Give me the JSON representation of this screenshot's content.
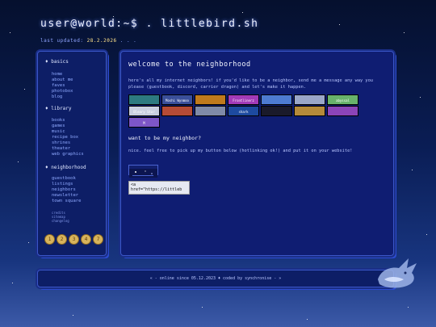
{
  "header": {
    "title": "user@world:~$ . littlebird.sh",
    "updated_label": "last updated:",
    "updated_date": "28.2.2026",
    "updated_suffix": ". . ."
  },
  "sidebar": {
    "basics": {
      "heading": "basics",
      "links": [
        "home",
        "about me",
        "faves",
        "photobox",
        "blog"
      ]
    },
    "library": {
      "heading": "library",
      "links": [
        "books",
        "games",
        "music",
        "recipe box",
        "shrines",
        "theater",
        "web graphics"
      ]
    },
    "neighborhood": {
      "heading": "neighborhood",
      "links": [
        "guestbook",
        "listings",
        "neighbors",
        "newsletter",
        "town square"
      ]
    },
    "tiny_links": [
      "credits",
      "sitemap",
      "changelog"
    ],
    "badges": [
      "1",
      "2",
      "3",
      "4",
      "7"
    ]
  },
  "main": {
    "title": "welcome to the neighborhood",
    "intro": "here's all my internet neighbors! if you'd like to be a neighbor, send me a message any way you please (guestbook, discord, carrier dragon) and let's make it happen.",
    "buttons": [
      {
        "label": "",
        "bg": "#2d7a80"
      },
      {
        "label": "Moshi Wynmoo",
        "bg": "#3a4f9a"
      },
      {
        "label": "",
        "bg": "#c07a1d"
      },
      {
        "label": "Frontlinerz Gaming",
        "bg": "#a23ab8"
      },
      {
        "label": "",
        "bg": "#4d7bd1"
      },
      {
        "label": "",
        "bg": "#9aa6c8"
      },
      {
        "label": "abyssal drowning",
        "bg": "#68b26b"
      },
      {
        "label": "Bleary Star Games",
        "bg": "#c9cfe0"
      },
      {
        "label": "",
        "bg": "#b64b36"
      },
      {
        "label": "",
        "bg": "#7f8aa8"
      },
      {
        "label": "shark",
        "bg": "#1d4aa0"
      },
      {
        "label": "",
        "bg": "#1a1a2a"
      },
      {
        "label": "",
        "bg": "#b58a3a"
      },
      {
        "label": "",
        "bg": "#8b44b8"
      },
      {
        "label": "M",
        "bg": "#7d56c8"
      }
    ],
    "subtitle": "want to be my neighbor?",
    "instructions": "nice. feel free to pick up my button below (hotlinking ok!) and put it on your website!",
    "code_value": "<a\nhref=\"https://littleb"
  },
  "footer": {
    "text": "« - online since 05.12.2023 ♦ coded by synchronise - »"
  }
}
